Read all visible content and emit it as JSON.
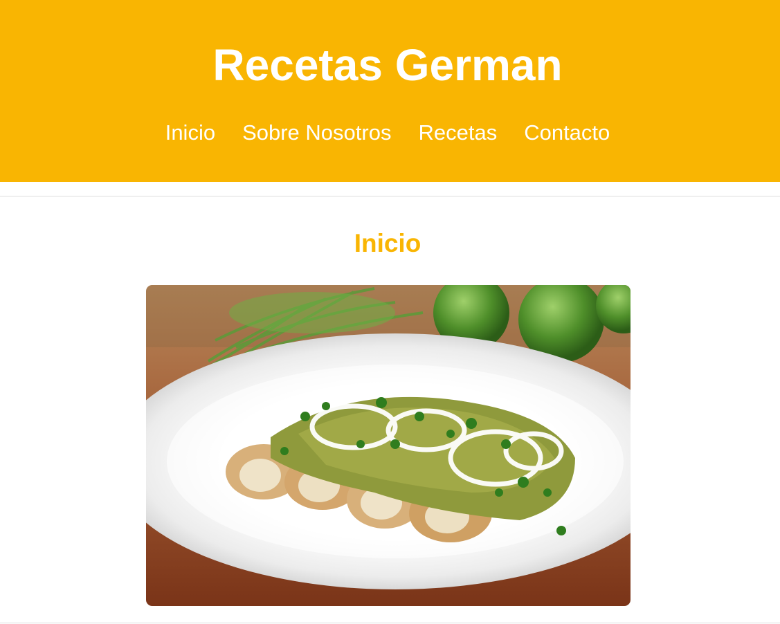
{
  "header": {
    "site_title": "Recetas German",
    "nav": [
      {
        "label": "Inicio"
      },
      {
        "label": "Sobre Nosotros"
      },
      {
        "label": "Recetas"
      },
      {
        "label": "Contacto"
      }
    ]
  },
  "main": {
    "heading": "Inicio",
    "hero_image": {
      "alt": "Enchiladas verdes"
    }
  },
  "colors": {
    "header_bg": "#F9B502",
    "heading": "#F9B502",
    "header_text": "#FFFFFF"
  }
}
